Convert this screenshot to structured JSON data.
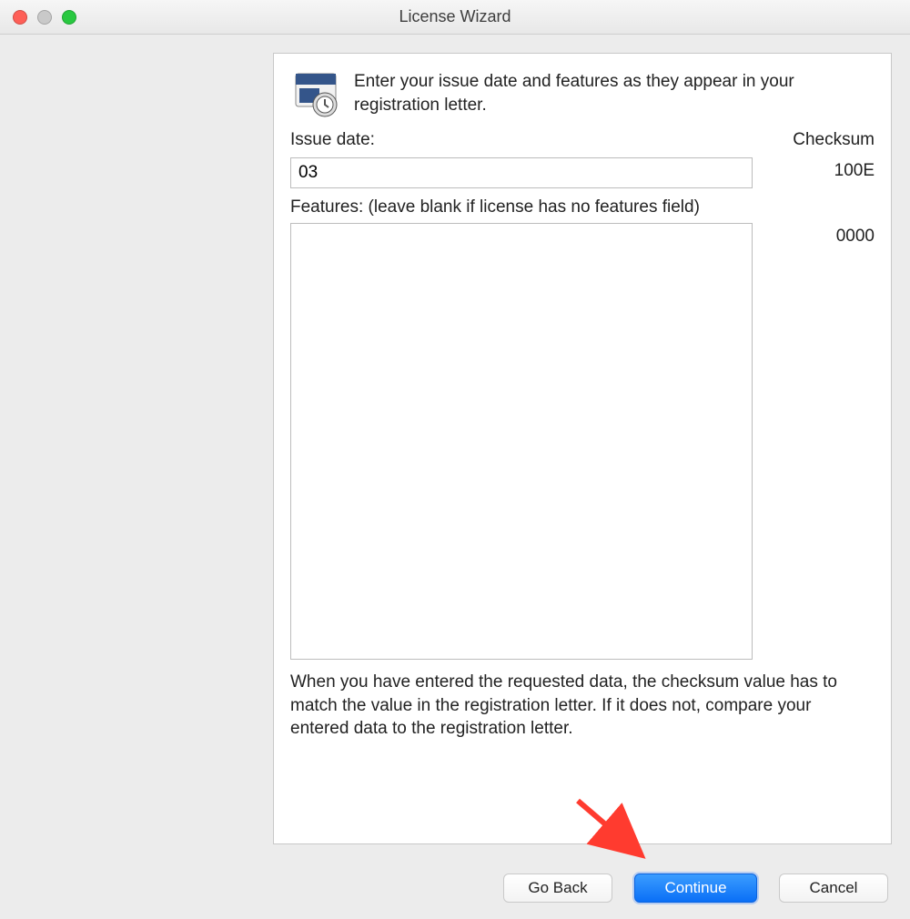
{
  "window": {
    "title": "License Wizard"
  },
  "panel": {
    "intro": "Enter your issue date and features as they appear in your registration letter.",
    "issue_date_label": "Issue date:",
    "checksum_label": "Checksum",
    "issue_date_value": "03",
    "issue_date_checksum": "100E",
    "features_label": "Features: (leave blank if license has no features field)",
    "features_value": "",
    "features_checksum": "0000",
    "help": "When you have entered the requested data, the checksum value has to match the value in the registration letter.  If it does not, compare your entered data to the registration letter."
  },
  "buttons": {
    "back": "Go Back",
    "continue": "Continue",
    "cancel": "Cancel"
  }
}
